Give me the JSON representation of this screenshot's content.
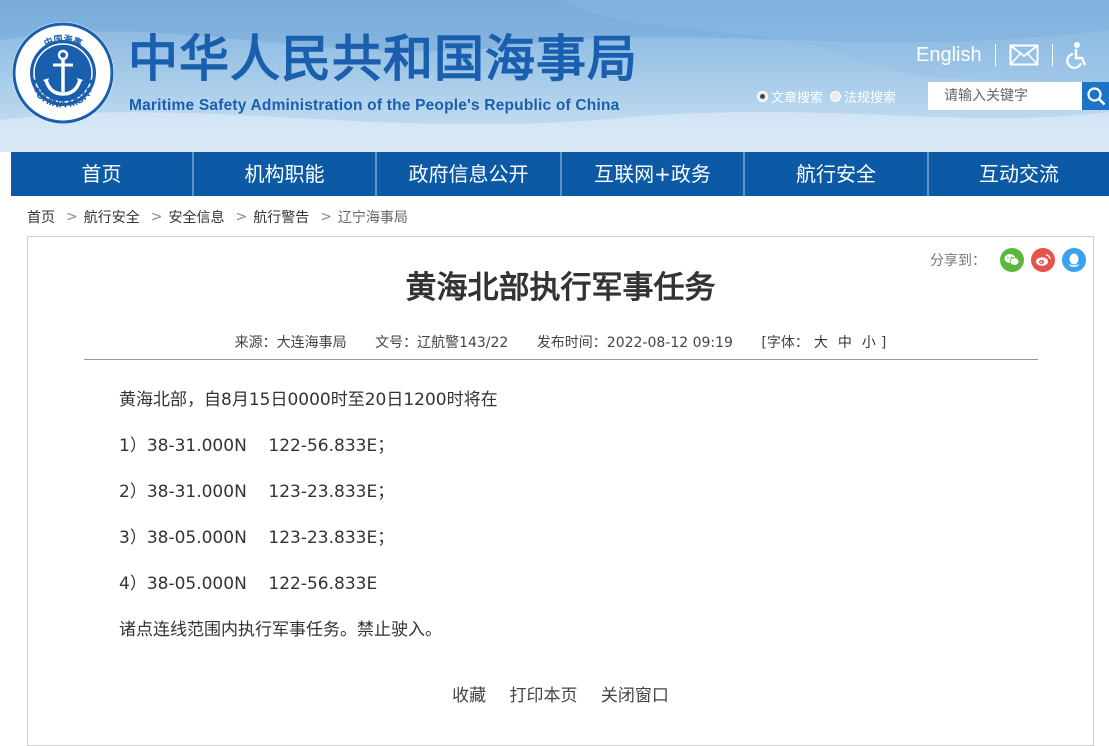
{
  "header": {
    "logo_text": "CHINA MSA",
    "logo_top_text": "中国海事",
    "title_cn": "中华人民共和国海事局",
    "title_en": "Maritime Safety Administration of the People's Republic of China",
    "english_link": "English",
    "search": {
      "option_article": "文章搜索",
      "option_law": "法规搜索",
      "placeholder": "请输入关键字"
    }
  },
  "nav": {
    "items": [
      {
        "label": "首页"
      },
      {
        "label": "机构职能"
      },
      {
        "label": "政府信息公开"
      },
      {
        "label": "互联网+政务"
      },
      {
        "label": "航行安全"
      },
      {
        "label": "互动交流"
      }
    ]
  },
  "breadcrumb": [
    "首页",
    "航行安全",
    "安全信息",
    "航行警告",
    "辽宁海事局"
  ],
  "article": {
    "share_label": "分享到：",
    "title": "黄海北部执行军事任务",
    "meta": {
      "source": "来源：大连海事局",
      "doc_no": "文号：辽航警143/22",
      "publish_time": "发布时间：2022-08-12 09:19",
      "font_size_label": "[字体：",
      "font_large": "大",
      "font_medium": "中",
      "font_small": "小",
      "font_close": "]"
    },
    "paragraphs": [
      "黄海北部，自8月15日0000时至20日1200时将在",
      "1）38-31.000N    122-56.833E；",
      "2）38-31.000N    123-23.833E；",
      "3）38-05.000N    123-23.833E；",
      "4）38-05.000N    122-56.833E",
      "诸点连线范围内执行军事任务。禁止驶入。"
    ],
    "actions": {
      "favorite": "收藏",
      "print": "打印本页",
      "close": "关闭窗口"
    }
  },
  "colors": {
    "brand_blue": "#1a5fae",
    "nav_bg": "#0c5aa6",
    "wechat": "#5ab83b",
    "weibo": "#e5534b",
    "qq": "#3aa3ef"
  }
}
